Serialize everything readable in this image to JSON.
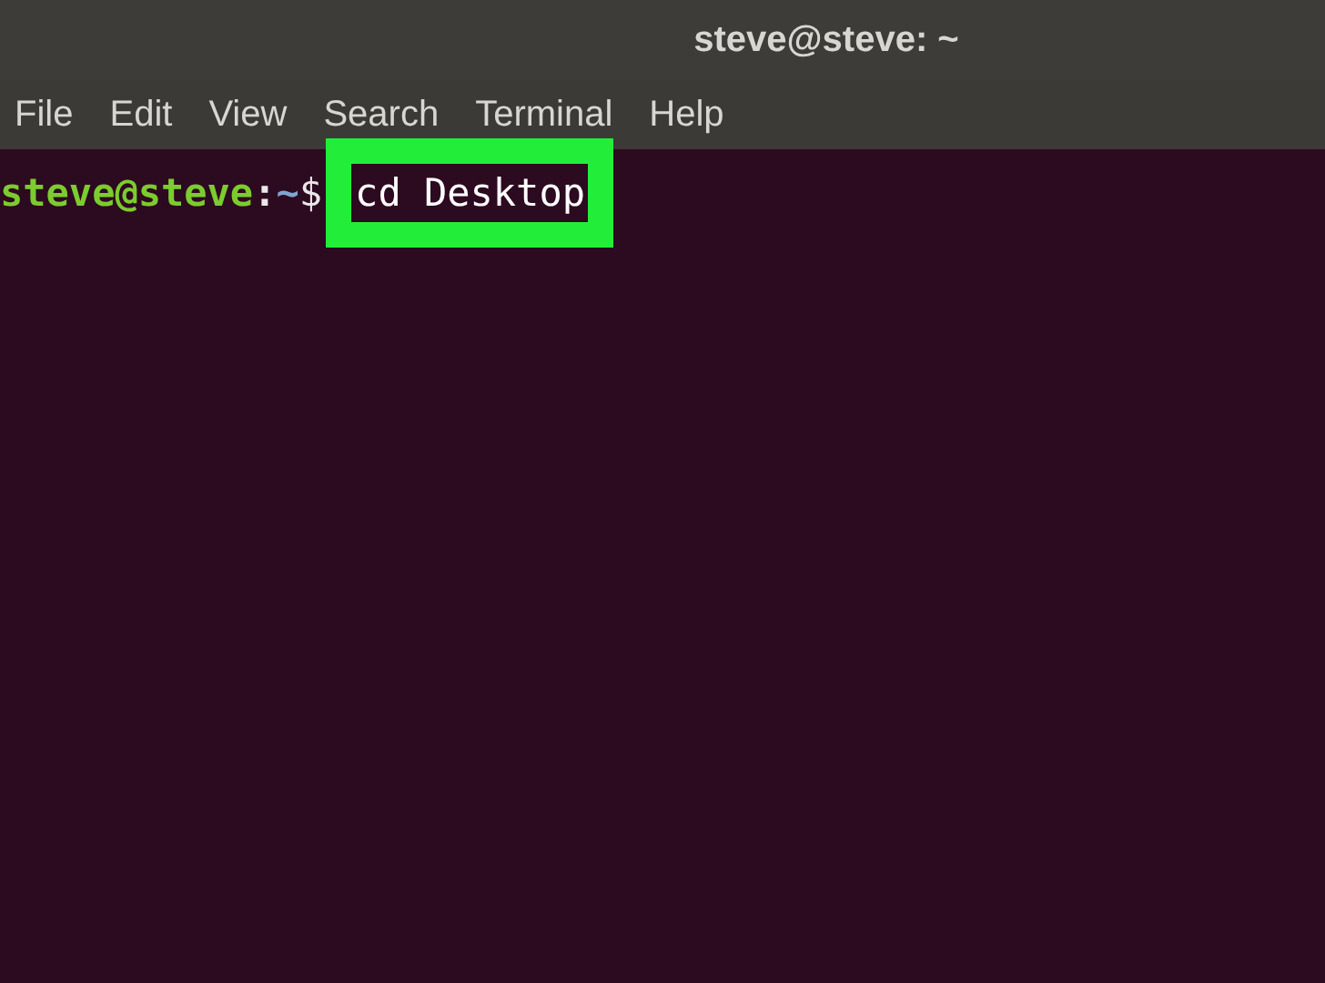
{
  "window": {
    "title": "steve@steve: ~"
  },
  "menu": [
    "File",
    "Edit",
    "View",
    "Search",
    "Terminal",
    "Help"
  ],
  "terminal": {
    "user_host": "steve@steve",
    "separator": ":",
    "path": "~",
    "prompt_symbol": "$",
    "command": "cd Desktop",
    "command_highlighted": true
  }
}
